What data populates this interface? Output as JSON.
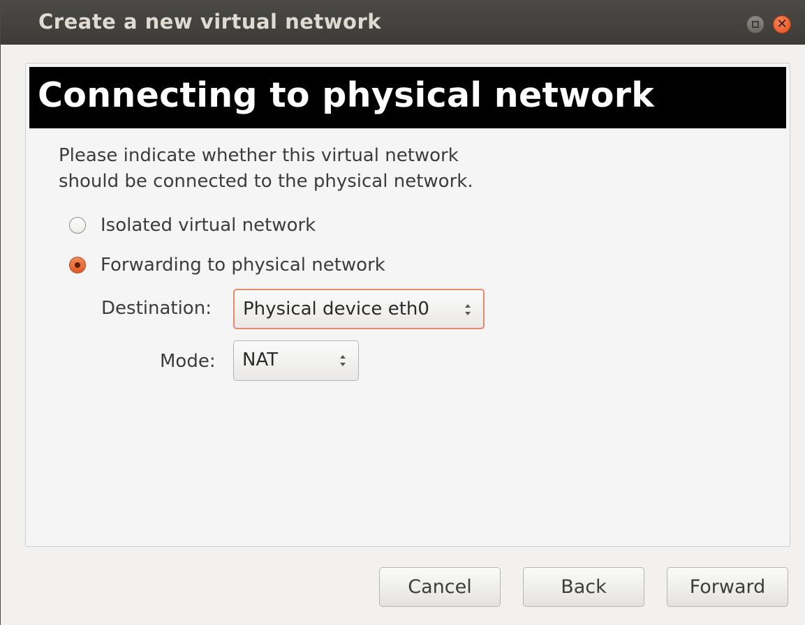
{
  "window": {
    "title": "Create a new virtual network"
  },
  "banner": {
    "title": "Connecting to physical network"
  },
  "description": "Please indicate whether this virtual network\nshould be connected to the physical network.",
  "options": {
    "isolated": {
      "label": "Isolated virtual network",
      "selected": false
    },
    "forwarding": {
      "label": "Forwarding to physical network",
      "selected": true
    }
  },
  "destination": {
    "label": "Destination:",
    "value": "Physical device eth0"
  },
  "mode": {
    "label": "Mode:",
    "value": "NAT"
  },
  "buttons": {
    "cancel": "Cancel",
    "back": "Back",
    "forward": "Forward"
  },
  "icons": {
    "maximize": "maximize-icon",
    "close": "close-icon",
    "combo_arrows": "updown-arrows-icon"
  },
  "colors": {
    "accent": "#e05a24",
    "titlebar": "#3c3b37",
    "banner": "#000000"
  }
}
